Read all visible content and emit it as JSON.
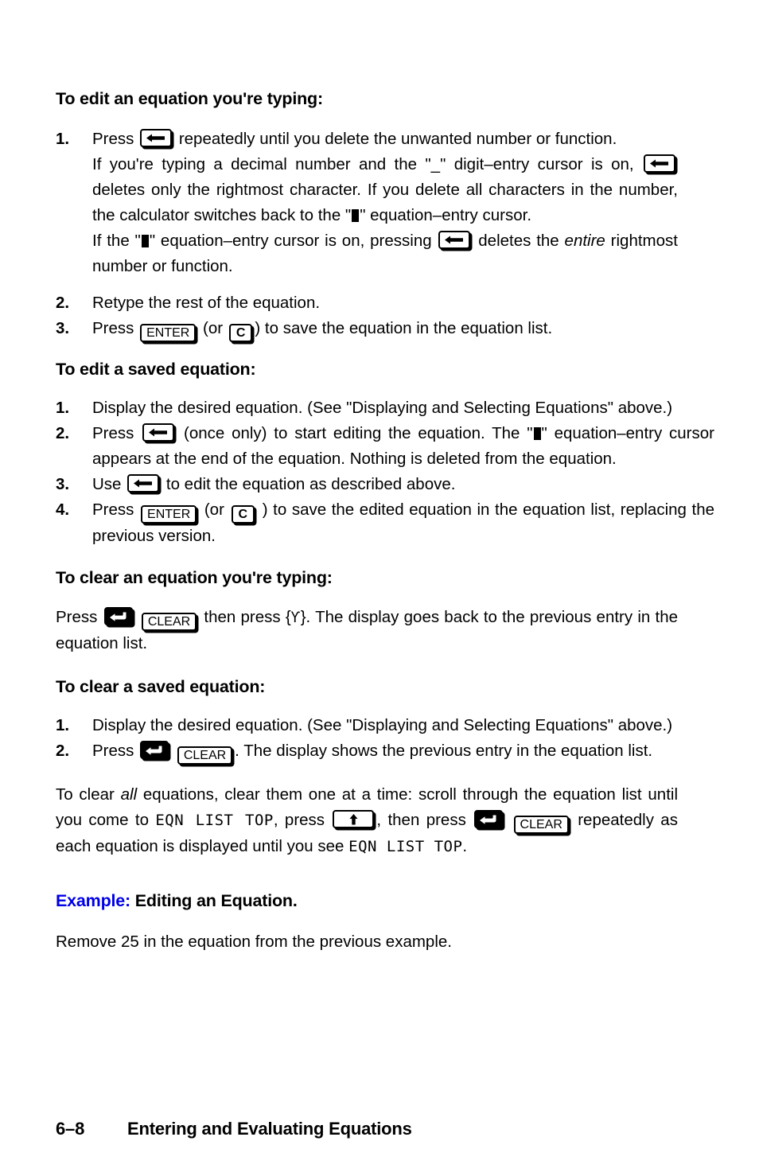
{
  "sections": [
    {
      "heading": "To edit an equation you're typing:",
      "steps": [
        {
          "num": "1.",
          "text_before": "Press ",
          "key": "backspace",
          "text_after": " repeatedly until you delete the unwanted number or function."
        }
      ],
      "paragraphs": [
        "If you're typing a decimal number and the \"_\" digit–entry cursor is on, [backspace-key] deletes only the rightmost character. If you delete all characters in the number, the calculator switches back to the \"[cursor]\" equation–entry cursor.",
        "If the \"[cursor]\" equation–entry cursor is on, pressing [backspace-key] deletes the entire rightmost number or function."
      ],
      "steps2": [
        {
          "num": "2.",
          "text": "Retype the rest of the equation."
        },
        {
          "num": "3.",
          "text_before": "Press ",
          "key1": "ENTER",
          "text_mid": " (or ",
          "key2": "C",
          "text_after": ") to save the equation in the equation list."
        }
      ]
    },
    {
      "heading": "To edit a saved equation:",
      "steps": [
        {
          "num": "1.",
          "text": "Display the desired equation. (See \"Displaying and Selecting Equations\" above.)"
        },
        {
          "num": "2.",
          "text_before": "Press ",
          "key": "backspace",
          "text_after": " (once only) to start editing the equation. The \"[cursor]\" equation–entry cursor appears at the end of the equation. Nothing is deleted from the equation."
        },
        {
          "num": "3.",
          "text_before": "Use ",
          "key": "backspace",
          "text_after": " to edit the equation as described above."
        },
        {
          "num": "4.",
          "text_before": "Press ",
          "key1": "ENTER",
          "text_mid": " (or ",
          "key2": "C",
          "text_after": " ) to save the edited equation in the equation list, replacing the previous version."
        }
      ]
    },
    {
      "heading": "To clear an equation you're typing:",
      "paragraph": "Press [shift-key] [CLEAR-key] then press {Ƴ}. The display goes back to the previous entry in the equation list."
    },
    {
      "heading": "To clear a saved equation:",
      "steps": [
        {
          "num": "1.",
          "text": "Display the desired equation. (See \"Displaying and Selecting Equations\" above.)"
        },
        {
          "num": "2.",
          "text_before": "Press ",
          "text_after": ". The display shows the previous entry in the equation list."
        }
      ]
    }
  ],
  "text": {
    "s1_step1_before": "Press",
    "s1_step1_after": "repeatedly until you delete the unwanted number or function.",
    "s1_p1_a": "If you're typing a decimal number and the \"_\" digit–entry cursor is on,",
    "s1_p1_b": "deletes only the rightmost character. If you delete all characters in the number, the calculator switches back to the \"",
    "s1_p1_c": "\" equation–entry cursor.",
    "s1_p2_a": "If the \"",
    "s1_p2_b": "\" equation–entry cursor is on, pressing",
    "s1_p2_c": "deletes the",
    "s1_p2_italic": "entire",
    "s1_p2_d": "rightmost number or function.",
    "s1_step2": "Retype the rest of the equation.",
    "s1_step3_a": "Press",
    "s1_step3_b": "(or",
    "s1_step3_c": ") to save the equation in the equation list.",
    "s2_step1": "Display the desired equation. (See \"Displaying and Selecting Equations\" above.)",
    "s2_step2_a": "Press",
    "s2_step2_b": "(once only) to start editing the equation. The \"",
    "s2_step2_c": "\" equation–entry cursor appears at the end of the equation. Nothing is deleted from the equation.",
    "s2_step3_a": "Use",
    "s2_step3_b": "to edit the equation as described above.",
    "s2_step4_a": "Press",
    "s2_step4_b": "(or",
    "s2_step4_c": ") to save the edited equation in the equation list, replacing the previous version.",
    "s3_p_a": "Press",
    "s3_p_b": "then press {",
    "s3_p_y": "Ƴ",
    "s3_p_c": "}. The display goes back to the previous entry in the equation list.",
    "s4_step1": "Display the desired equation. (See \"Displaying and Selecting Equations\" above.)",
    "s4_step2_a": "Press",
    "s4_step2_b": ". The display shows the previous entry in the equation list.",
    "clear_all_a": "To clear",
    "clear_all_italic": "all",
    "clear_all_b": "equations, clear them one at a time: scroll through the equation list until you come to",
    "clear_all_eqn1": "EQN LIST TOP",
    "clear_all_c": ", press",
    "clear_all_d": ", then press",
    "clear_all_e": "repeatedly as each equation is displayed until you see",
    "clear_all_eqn2": "EQN LIST TOP",
    "clear_all_f": ".",
    "example_label": "Example:",
    "example_title": "Editing an Equation.",
    "example_body": "Remove 25 in the equation from the previous example."
  },
  "headings": {
    "h1": "To edit an equation you're typing:",
    "h2": "To edit a saved equation:",
    "h3": "To clear an equation you're typing:",
    "h4": "To clear a saved equation:"
  },
  "numbers": {
    "n1": "1.",
    "n2": "2.",
    "n3": "3.",
    "n4": "4."
  },
  "keys": {
    "enter": "ENTER",
    "c": "C",
    "clear": "CLEAR"
  },
  "footer": {
    "page": "6–8",
    "chapter": "Entering and Evaluating Equations"
  },
  "colors": {
    "example_blue": "#0000E6",
    "ink": "#000000",
    "paper": "#ffffff"
  }
}
